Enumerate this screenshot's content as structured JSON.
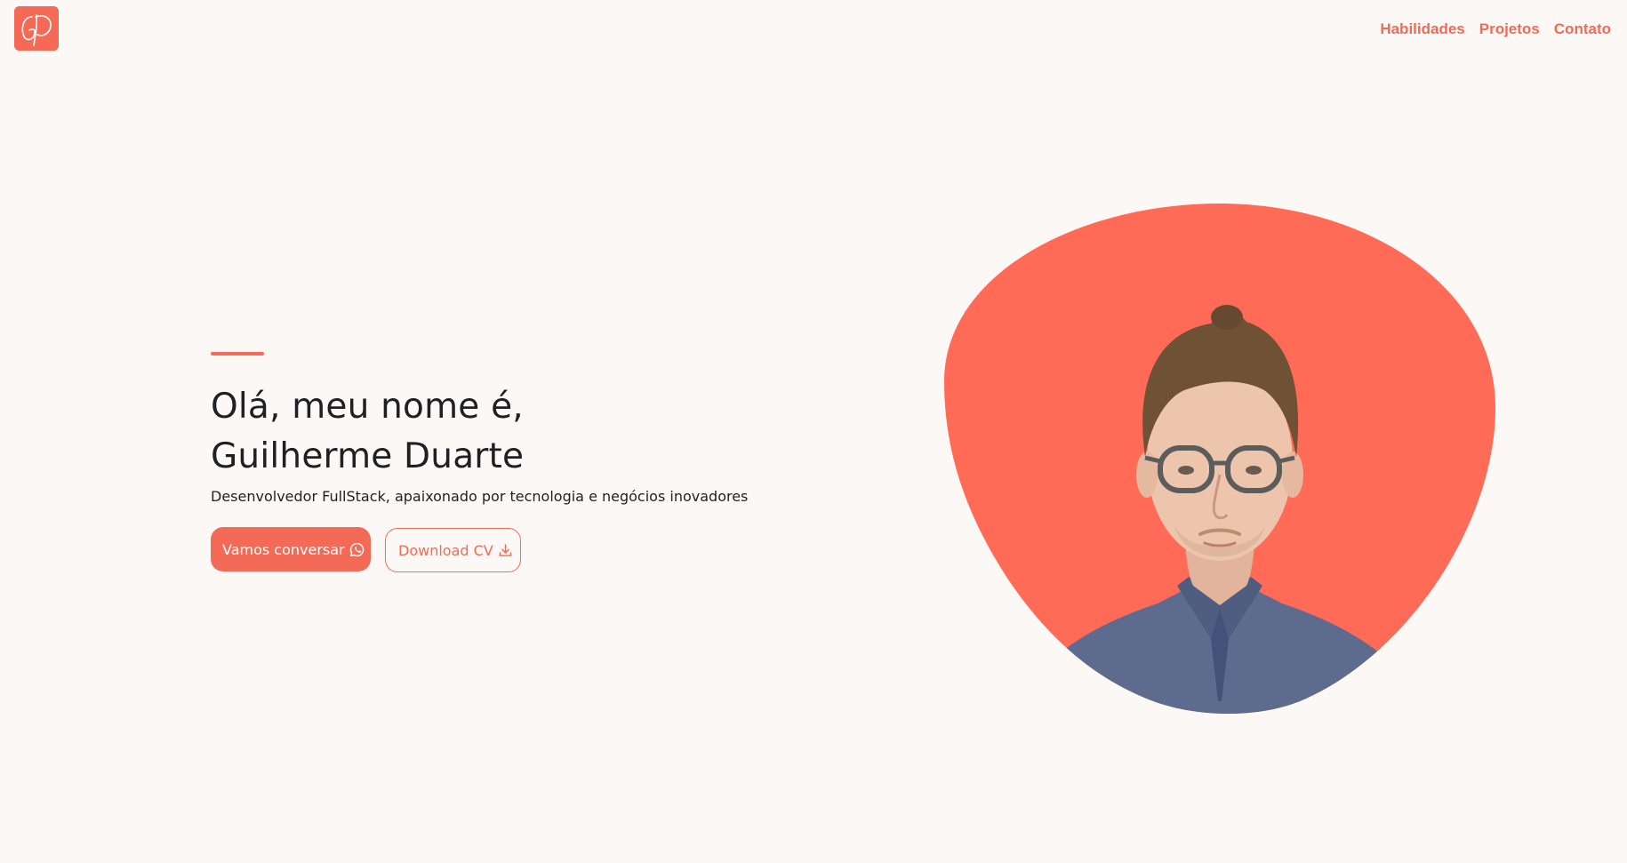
{
  "header": {
    "logo_text": "GD",
    "nav": [
      {
        "label": "Habilidades"
      },
      {
        "label": "Projetos"
      },
      {
        "label": "Contato"
      }
    ]
  },
  "hero": {
    "title_line1": "Olá, meu nome é,",
    "title_line2": "Guilherme Duarte",
    "subtitle": "Desenvolvedor FullStack, apaixonado por tecnologia e negócios inovadores",
    "primary_button": {
      "label": "Vamos conversar",
      "icon": "whatsapp-icon"
    },
    "secondary_button": {
      "label": "Download CV",
      "icon": "download-icon"
    }
  },
  "portrait": {
    "blob_color": "#ff6b57",
    "alt": "Guilherme Duarte"
  },
  "colors": {
    "accent": "#f36a56",
    "background": "#fcf8f6",
    "text": "#222226"
  }
}
